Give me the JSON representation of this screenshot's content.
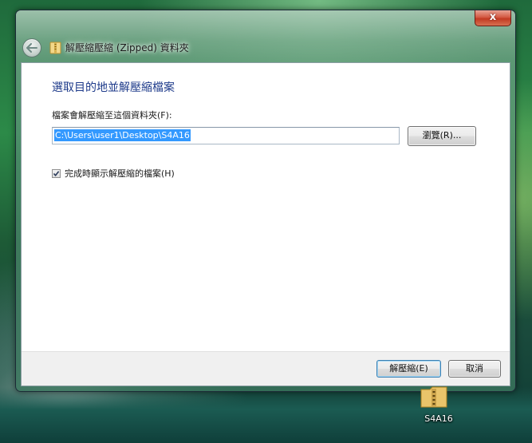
{
  "window": {
    "title": "解壓縮壓縮 (Zipped) 資料夾",
    "close_glyph": "x"
  },
  "dialog": {
    "heading": "選取目的地並解壓縮檔案",
    "destination_label": "檔案會解壓縮至這個資料夾(F):",
    "destination_value": "C:\\Users\\user1\\Desktop\\S4A16",
    "browse_button": "瀏覽(R)...",
    "show_files_checkbox": {
      "label": "完成時顯示解壓縮的檔案(H)",
      "checked": true
    }
  },
  "footer": {
    "extract_button": "解壓縮(E)",
    "cancel_button": "取消"
  },
  "desktop": {
    "icon_label": "S4A16",
    "icon": "zip-folder-icon"
  },
  "colors": {
    "heading": "#1d3a8a",
    "selection": "#3399ff",
    "close_button": "#c23a22"
  }
}
